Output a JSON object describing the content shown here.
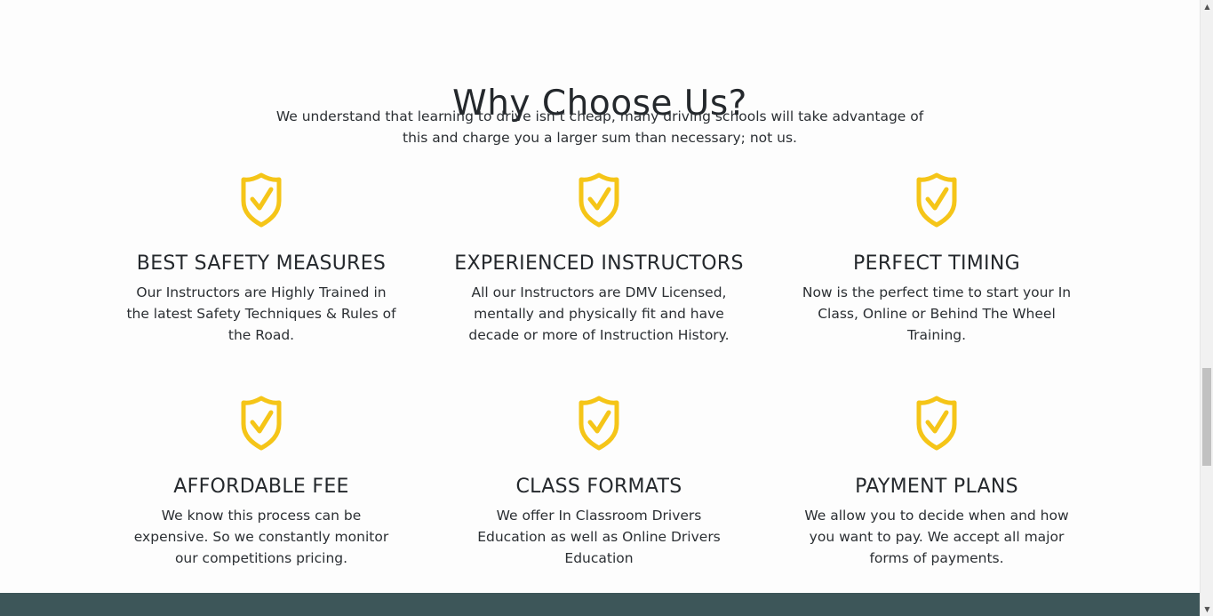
{
  "section": {
    "title": "Why Choose Us?",
    "intro": "We understand that learning to drive isn’t cheap, many driving schools will take advantage of this and charge you a larger sum than necessary; not us."
  },
  "features": [
    {
      "title": "BEST SAFETY MEASURES",
      "description": "Our Instructors are Highly Trained in the latest Safety Techniques & Rules of the Road."
    },
    {
      "title": "EXPERIENCED INSTRUCTORS",
      "description": "All our Instructors are DMV Licensed, mentally and physically fit and have decade or more of Instruction History."
    },
    {
      "title": "PERFECT TIMING",
      "description": "Now is the perfect time to start your In Class, Online or Behind The Wheel Training."
    },
    {
      "title": "AFFORDABLE FEE",
      "description": "We know this process can be expensive. So we constantly monitor our competitions pricing."
    },
    {
      "title": "CLASS FORMATS",
      "description": "We offer In Classroom Drivers Education as well as Online Drivers Education"
    },
    {
      "title": "PAYMENT PLANS",
      "description": "We allow you to decide when and how you want to pay. We accept all major forms of payments."
    }
  ],
  "icon": {
    "name": "shield-check-icon",
    "color": "#f5c518"
  },
  "colors": {
    "footer_band": "#3d5659"
  },
  "scrollbar": {
    "up_arrow": "▲",
    "down_arrow": "▼"
  }
}
